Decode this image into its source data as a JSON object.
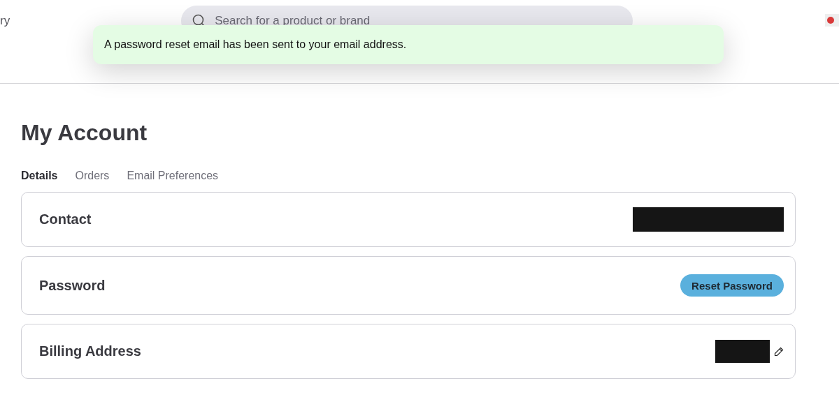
{
  "header": {
    "left_text": "ry",
    "search": {
      "placeholder": "Search for a product or brand"
    },
    "flag": true
  },
  "toast": {
    "message": "A password reset email has been sent to your email address."
  },
  "page": {
    "title": "My Account",
    "tabs": [
      {
        "label": "Details",
        "selected": true
      },
      {
        "label": "Orders",
        "selected": false
      },
      {
        "label": "Email Preferences",
        "selected": false
      }
    ],
    "sections": [
      {
        "title": "Contact",
        "kind": "redacted",
        "editable": false
      },
      {
        "title": "Password",
        "kind": "button",
        "button": "Reset Password"
      },
      {
        "title": "Billing Address",
        "kind": "redacted",
        "editable": true
      }
    ]
  }
}
